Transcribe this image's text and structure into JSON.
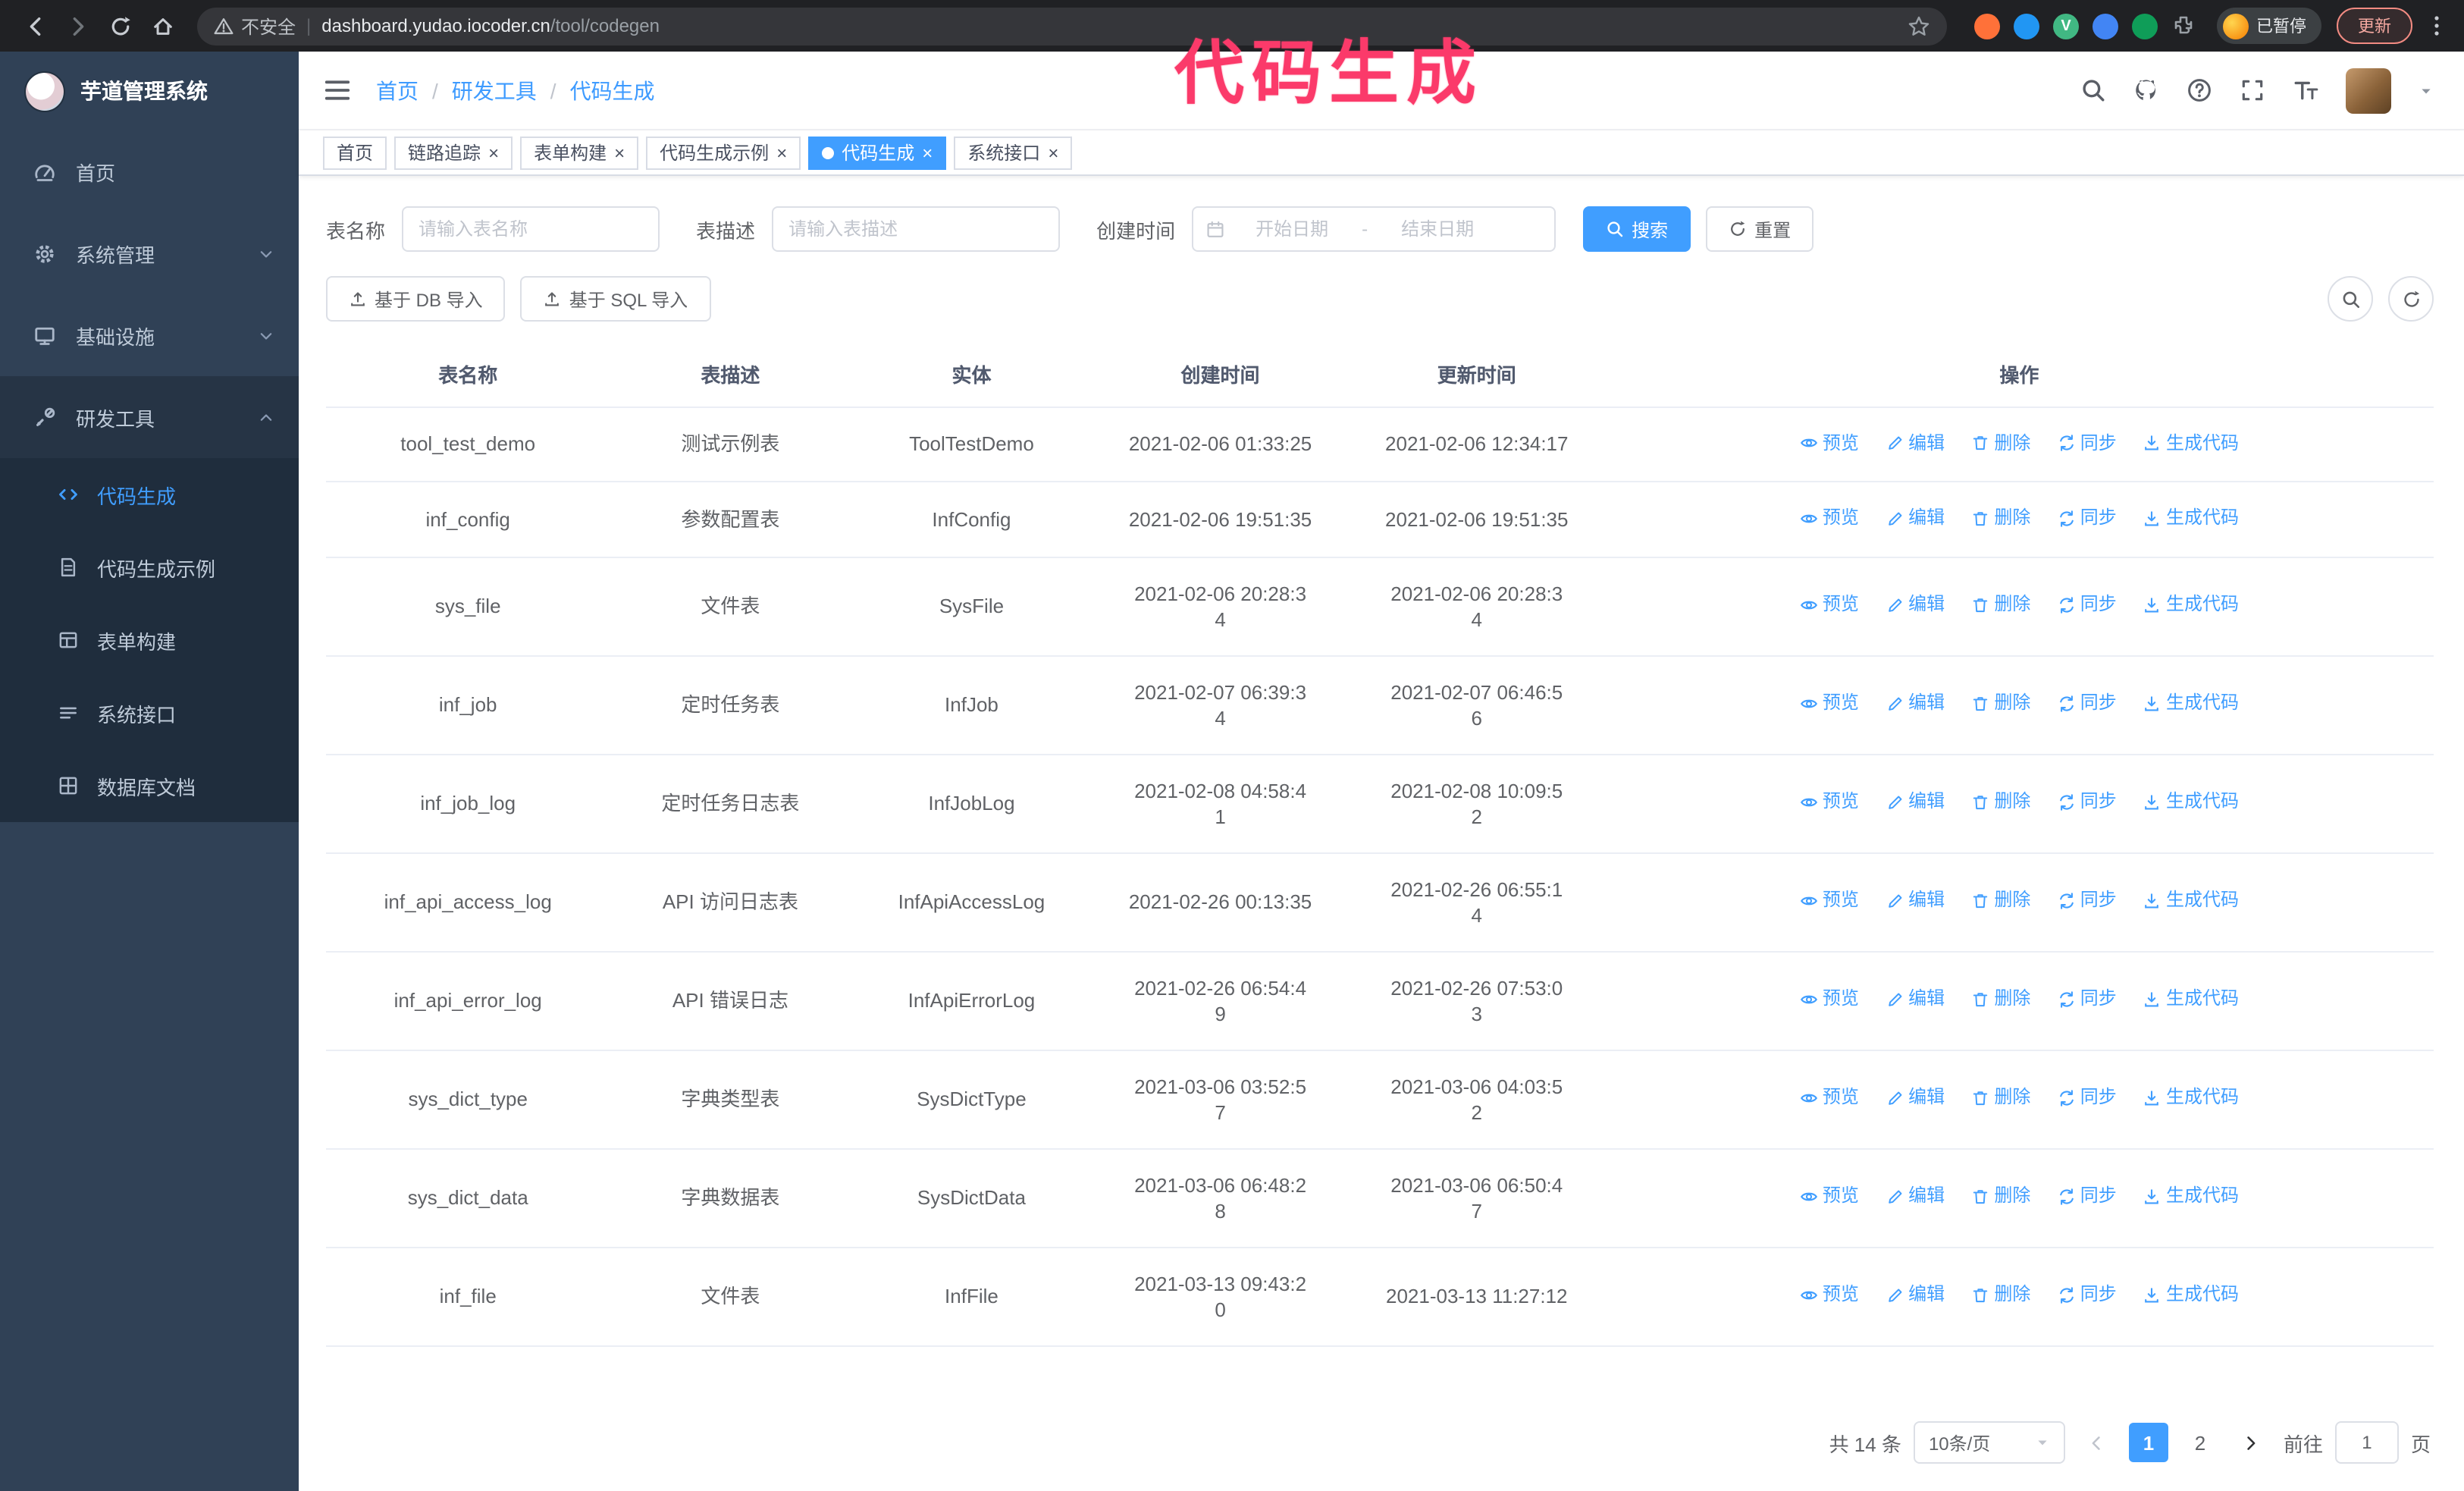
{
  "annotation": {
    "text": "代码生成"
  },
  "browser": {
    "security_label": "不安全",
    "url_domain": "dashboard.yudao.iocoder.cn",
    "url_path": "/tool/codegen",
    "vue_icon_letter": "V",
    "paused_badge": "已暂停",
    "update_button": "更新"
  },
  "sidebar": {
    "logo_title": "芋道管理系统",
    "items": [
      {
        "label": "首页"
      },
      {
        "label": "系统管理"
      },
      {
        "label": "基础设施"
      },
      {
        "label": "研发工具"
      }
    ],
    "subitems": [
      {
        "label": "代码生成"
      },
      {
        "label": "代码生成示例"
      },
      {
        "label": "表单构建"
      },
      {
        "label": "系统接口"
      },
      {
        "label": "数据库文档"
      }
    ]
  },
  "header": {
    "breadcrumb": [
      "首页",
      "研发工具",
      "代码生成"
    ],
    "separator": "/"
  },
  "tabs": [
    {
      "label": "首页"
    },
    {
      "label": "链路追踪"
    },
    {
      "label": "表单构建"
    },
    {
      "label": "代码生成示例"
    },
    {
      "label": "代码生成"
    },
    {
      "label": "系统接口"
    }
  ],
  "filters": {
    "name_label": "表名称",
    "name_placeholder": "请输入表名称",
    "desc_label": "表描述",
    "desc_placeholder": "请输入表描述",
    "time_label": "创建时间",
    "start_placeholder": "开始日期",
    "range_separator": "-",
    "end_placeholder": "结束日期",
    "search_button": "搜索",
    "reset_button": "重置"
  },
  "toolbar": {
    "import_db_button": "基于 DB 导入",
    "import_sql_button": "基于 SQL 导入"
  },
  "table": {
    "columns": [
      "表名称",
      "表描述",
      "实体",
      "创建时间",
      "更新时间",
      "操作"
    ],
    "actions": [
      "预览",
      "编辑",
      "删除",
      "同步",
      "生成代码"
    ],
    "rows": [
      {
        "name": "tool_test_demo",
        "desc": "测试示例表",
        "entity": "ToolTestDemo",
        "created": "2021-02-06 01:33:25",
        "updated": "2021-02-06 12:34:17"
      },
      {
        "name": "inf_config",
        "desc": "参数配置表",
        "entity": "InfConfig",
        "created": "2021-02-06 19:51:35",
        "updated": "2021-02-06 19:51:35"
      },
      {
        "name": "sys_file",
        "desc": "文件表",
        "entity": "SysFile",
        "created": "2021-02-06 20:28:3\n4",
        "updated": "2021-02-06 20:28:3\n4"
      },
      {
        "name": "inf_job",
        "desc": "定时任务表",
        "entity": "InfJob",
        "created": "2021-02-07 06:39:3\n4",
        "updated": "2021-02-07 06:46:5\n6"
      },
      {
        "name": "inf_job_log",
        "desc": "定时任务日志表",
        "entity": "InfJobLog",
        "created": "2021-02-08 04:58:4\n1",
        "updated": "2021-02-08 10:09:5\n2"
      },
      {
        "name": "inf_api_access_log",
        "desc": "API 访问日志表",
        "entity": "InfApiAccessLog",
        "created": "2021-02-26 00:13:35",
        "updated": "2021-02-26 06:55:1\n4"
      },
      {
        "name": "inf_api_error_log",
        "desc": "API 错误日志",
        "entity": "InfApiErrorLog",
        "created": "2021-02-26 06:54:4\n9",
        "updated": "2021-02-26 07:53:0\n3"
      },
      {
        "name": "sys_dict_type",
        "desc": "字典类型表",
        "entity": "SysDictType",
        "created": "2021-03-06 03:52:5\n7",
        "updated": "2021-03-06 04:03:5\n2"
      },
      {
        "name": "sys_dict_data",
        "desc": "字典数据表",
        "entity": "SysDictData",
        "created": "2021-03-06 06:48:2\n8",
        "updated": "2021-03-06 06:50:4\n7"
      },
      {
        "name": "inf_file",
        "desc": "文件表",
        "entity": "InfFile",
        "created": "2021-03-13 09:43:2\n0",
        "updated": "2021-03-13 11:27:12"
      }
    ]
  },
  "pagination": {
    "total": "共 14 条",
    "page_size": "10条/页",
    "page_1": "1",
    "page_2": "2",
    "goto_label": "前往",
    "goto_value": "1",
    "unit_label": "页"
  },
  "colors": {
    "accent": "#409eff",
    "annotation": "#fb3a6a",
    "sidebar": "#304156"
  }
}
